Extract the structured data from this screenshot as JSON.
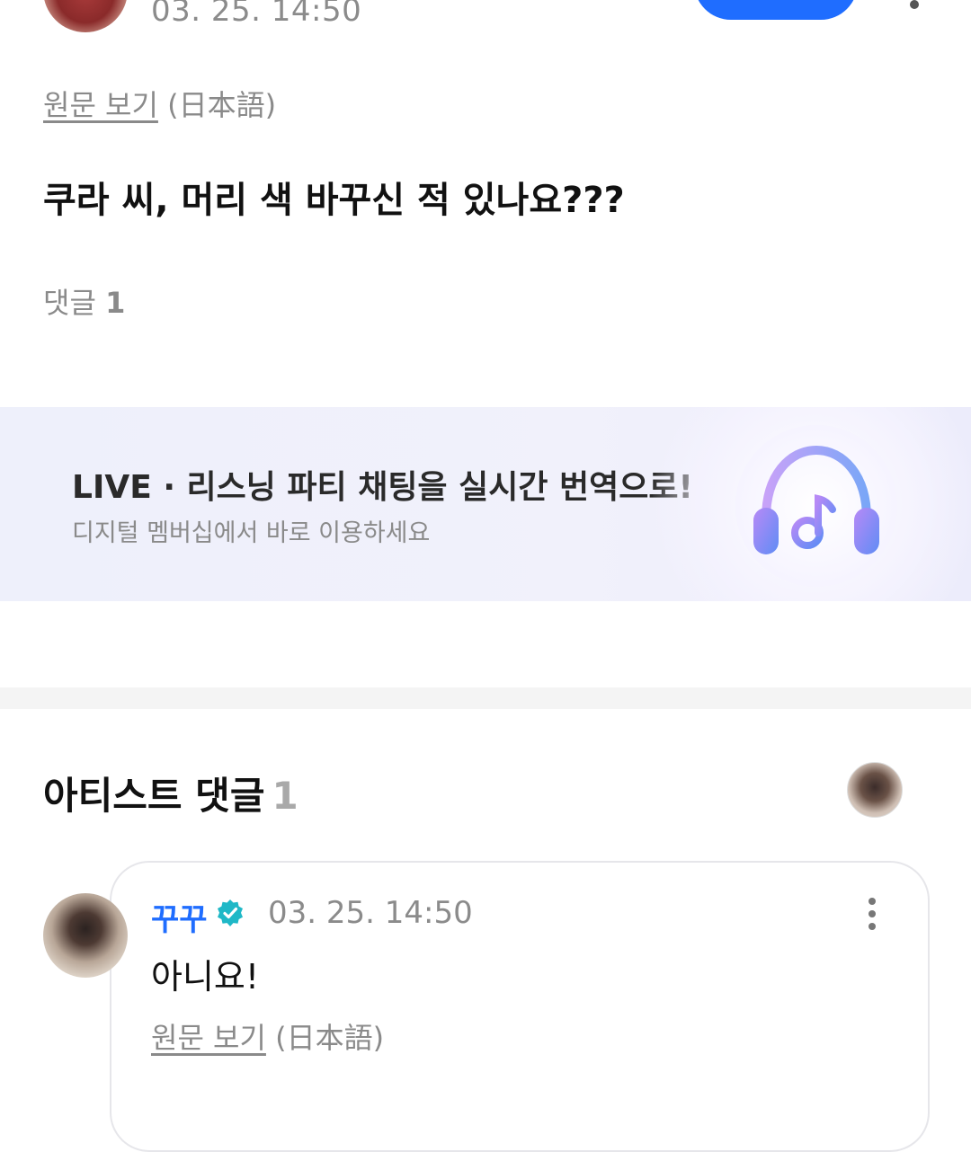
{
  "post": {
    "timestamp": "03. 25. 14:50",
    "view_original_label": "원문 보기",
    "original_language": "(日本語)",
    "body": "쿠라 씨, 머리 색 바꾸신 적 있나요???",
    "comments_label": "댓글",
    "comments_count": "1"
  },
  "banner": {
    "title": "LIVE · 리스닝 파티 채팅을 실시간 번역으로!",
    "subtitle": "디지털 멤버십에서 바로 이용하세요",
    "icon": "headphones-music-icon",
    "accent_from": "#a67cf2",
    "accent_to": "#5f8cf5"
  },
  "artist_comments": {
    "title": "아티스트 댓글",
    "count": "1",
    "items": [
      {
        "author": "꾸꾸",
        "verified": true,
        "timestamp": "03. 25. 14:50",
        "body": "아니요!",
        "view_original_label": "원문 보기",
        "original_language": "(日本語)"
      }
    ]
  },
  "colors": {
    "brand_blue": "#1f6dff",
    "verified_teal": "#1fb8c7",
    "muted_text": "#8a8a8a"
  }
}
